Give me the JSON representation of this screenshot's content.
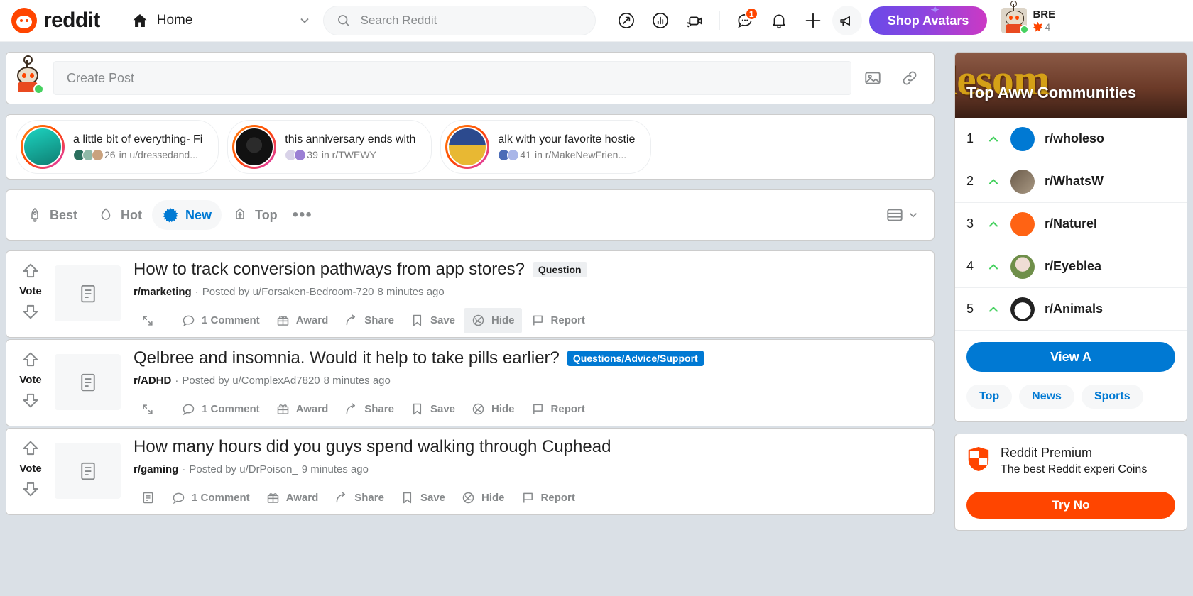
{
  "header": {
    "brand": "reddit",
    "home_label": "Home",
    "search_placeholder": "Search Reddit",
    "icons": {
      "popular": "popular-icon",
      "trending": "trending-icon",
      "live": "live-video-icon",
      "chat": "chat-icon",
      "chat_badge": "1",
      "notifications": "bell-icon",
      "create": "plus-icon",
      "advertise": "megaphone-icon"
    },
    "shop_avatars": "Shop Avatars",
    "user": {
      "name": "BRE",
      "karma": "4"
    }
  },
  "create_post": {
    "placeholder": "Create Post",
    "image_icon": "image-icon",
    "link_icon": "link-icon"
  },
  "carousel": [
    {
      "title": "a little bit of everything- Fi",
      "count": "26",
      "where": "in u/dressedand...",
      "ring": "#FF8717"
    },
    {
      "title": "this anniversary ends with",
      "count": "39",
      "where": "in r/TWEWY",
      "ring": "#DB3BCC"
    },
    {
      "title": "alk with your favorite hostie",
      "count": "41",
      "where": "in r/MakeNewFrien...",
      "ring": "#FF4500"
    }
  ],
  "sort": {
    "options": [
      {
        "label": "Best",
        "icon": "rocket-icon",
        "active": false
      },
      {
        "label": "Hot",
        "icon": "flame-icon",
        "active": false
      },
      {
        "label": "New",
        "icon": "starburst-icon",
        "active": true
      },
      {
        "label": "Top",
        "icon": "podium-icon",
        "active": false
      }
    ],
    "more": "•••",
    "view_toggle": "card-view-icon"
  },
  "posts": [
    {
      "title": "How to track conversion pathways from app stores?",
      "flair": "Question",
      "flair_style": "grey",
      "subreddit": "r/marketing",
      "posted_by": "Posted by u/Forsaken-Bedroom-720",
      "time": "8 minutes ago",
      "vote_label": "Vote",
      "actions": [
        {
          "label": "1 Comment",
          "icon": "comment-icon",
          "hovered": false
        },
        {
          "label": "Award",
          "icon": "award-icon",
          "hovered": false
        },
        {
          "label": "Share",
          "icon": "share-icon",
          "hovered": false
        },
        {
          "label": "Save",
          "icon": "save-icon",
          "hovered": false
        },
        {
          "label": "Hide",
          "icon": "hide-icon",
          "hovered": true
        },
        {
          "label": "Report",
          "icon": "report-icon",
          "hovered": false
        }
      ],
      "expand_icon": "expand-icon",
      "thumb_icon": "text-post-icon"
    },
    {
      "title": "Qelbree and insomnia. Would it help to take pills earlier?",
      "flair": "Questions/Advice/Support",
      "flair_style": "blue",
      "subreddit": "r/ADHD",
      "posted_by": "Posted by u/ComplexAd7820",
      "time": "8 minutes ago",
      "vote_label": "Vote",
      "actions": [
        {
          "label": "1 Comment",
          "icon": "comment-icon",
          "hovered": false
        },
        {
          "label": "Award",
          "icon": "award-icon",
          "hovered": false
        },
        {
          "label": "Share",
          "icon": "share-icon",
          "hovered": false
        },
        {
          "label": "Save",
          "icon": "save-icon",
          "hovered": false
        },
        {
          "label": "Hide",
          "icon": "hide-icon",
          "hovered": false
        },
        {
          "label": "Report",
          "icon": "report-icon",
          "hovered": false
        }
      ],
      "expand_icon": "expand-icon",
      "thumb_icon": "text-post-icon"
    },
    {
      "title": "How many hours did you guys spend walking through Cuphead",
      "flair": "",
      "flair_style": "",
      "subreddit": "r/gaming",
      "posted_by": "Posted by u/DrPoison_",
      "time": "9 minutes ago",
      "vote_label": "Vote",
      "actions": [
        {
          "label": "1 Comment",
          "icon": "comment-icon",
          "hovered": false
        },
        {
          "label": "Award",
          "icon": "award-icon",
          "hovered": false
        },
        {
          "label": "Share",
          "icon": "share-icon",
          "hovered": false
        },
        {
          "label": "Save",
          "icon": "save-icon",
          "hovered": false
        },
        {
          "label": "Hide",
          "icon": "hide-icon",
          "hovered": false
        },
        {
          "label": "Report",
          "icon": "report-icon",
          "hovered": false
        }
      ],
      "expand_icon": "text-post-icon",
      "thumb_icon": "text-post-icon"
    }
  ],
  "sidebar": {
    "banner_word": "lesom",
    "banner_title": "Top Aww Communities",
    "communities": [
      {
        "rank": "1",
        "name": "r/wholeso",
        "color": "#0079D3"
      },
      {
        "rank": "2",
        "name": "r/WhatsW",
        "color": "#6B5B4A"
      },
      {
        "rank": "3",
        "name": "r/NatureI",
        "color": "#FF6314"
      },
      {
        "rank": "4",
        "name": "r/Eyeblea",
        "color": "#6F8F4A"
      },
      {
        "rank": "5",
        "name": "r/Animals",
        "color": "#FFFFFF"
      }
    ],
    "view_all": "View A",
    "pills": [
      "Top",
      "News",
      "Sports"
    ],
    "premium": {
      "title": "Reddit Premium",
      "desc": "The best Reddit experi Coins",
      "cta": "Try No"
    }
  }
}
